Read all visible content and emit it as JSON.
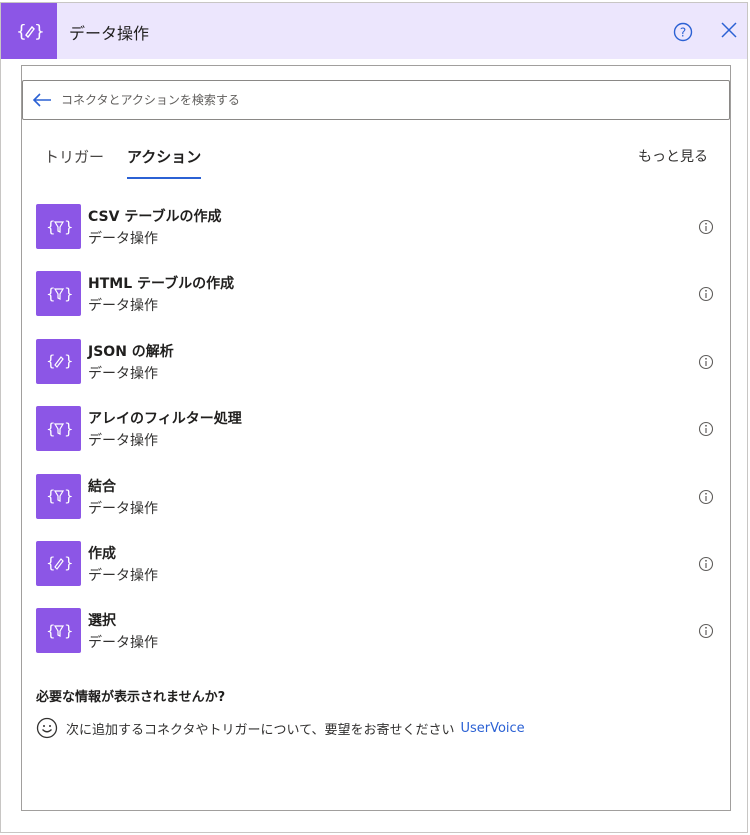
{
  "header": {
    "title": "データ操作",
    "logo_icon": "data-operation-icon",
    "help_icon": "question-circle-icon",
    "close_icon": "close-icon",
    "accent_color": "#8c56e6",
    "header_bg": "#ece6fd"
  },
  "search": {
    "placeholder": "コネクタとアクションを検索する",
    "value": ""
  },
  "tabs": [
    {
      "label": "トリガー",
      "selected": false
    },
    {
      "label": "アクション",
      "selected": true
    }
  ],
  "see_more_label": "もっと見る",
  "actions": [
    {
      "title": "CSV テーブルの作成",
      "subtitle": "データ操作",
      "icon": "filter-braces-icon"
    },
    {
      "title": "HTML テーブルの作成",
      "subtitle": "データ操作",
      "icon": "filter-braces-icon"
    },
    {
      "title": "JSON の解析",
      "subtitle": "データ操作",
      "icon": "pencil-braces-icon"
    },
    {
      "title": "アレイのフィルター処理",
      "subtitle": "データ操作",
      "icon": "filter-braces-icon"
    },
    {
      "title": "結合",
      "subtitle": "データ操作",
      "icon": "filter-braces-icon"
    },
    {
      "title": "作成",
      "subtitle": "データ操作",
      "icon": "pencil-braces-icon"
    },
    {
      "title": "選択",
      "subtitle": "データ操作",
      "icon": "filter-braces-icon"
    }
  ],
  "footer": {
    "missing_title": "必要な情報が表示されませんか?",
    "feedback_text": "次に追加するコネクタやトリガーについて、要望をお寄せください",
    "link_label": "UserVoice",
    "link_color": "#2b61d4"
  }
}
